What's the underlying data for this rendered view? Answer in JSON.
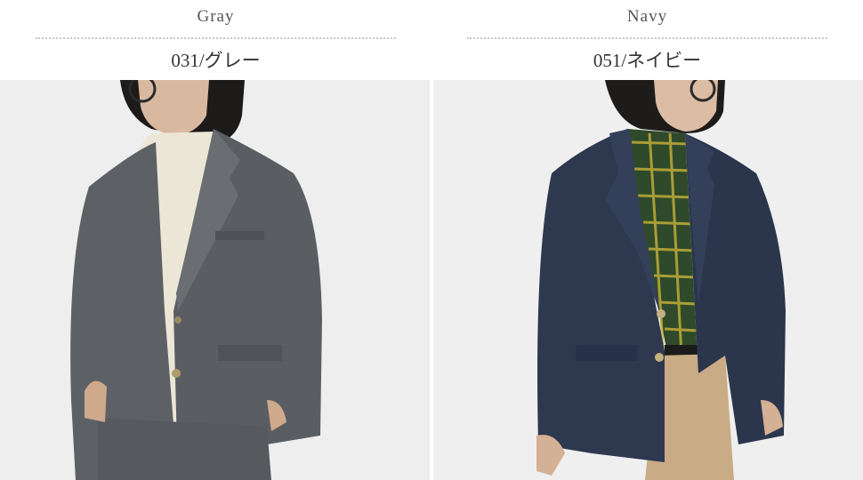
{
  "products": [
    {
      "color_name": "Gray",
      "color_code": "031/グレー",
      "jacket_color": "#5d6166",
      "inner_color": "#ece6d6",
      "bg_color": "#eeeeee"
    },
    {
      "color_name": "Navy",
      "color_code": "051/ネイビー",
      "jacket_color": "#2e3950",
      "inner_color": "#2f4a2a",
      "bg_color": "#efefef"
    }
  ]
}
